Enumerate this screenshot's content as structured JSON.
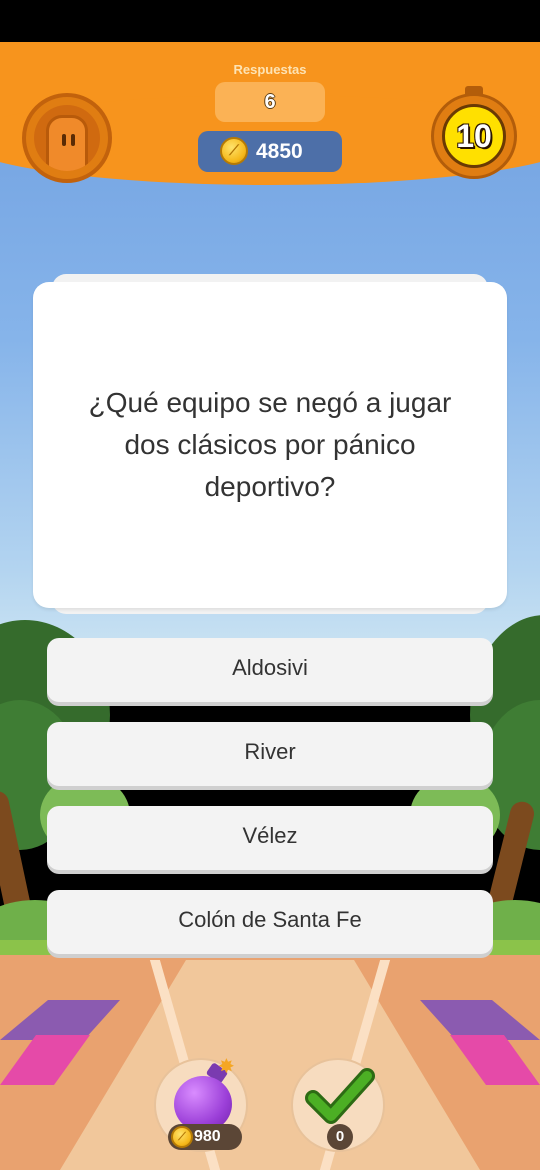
{
  "header": {
    "answers_label": "Respuestas",
    "answers_count": "6",
    "coins": "4850",
    "timer": "10"
  },
  "question": {
    "text": "¿Qué equipo se negó a jugar dos clásicos por pánico deportivo?"
  },
  "options": [
    {
      "label": "Aldosivi"
    },
    {
      "label": "River"
    },
    {
      "label": "Vélez"
    },
    {
      "label": "Colón de Santa Fe"
    }
  ],
  "powerups": {
    "bomb": {
      "icon": "bomb-icon",
      "price": "980"
    },
    "correct": {
      "icon": "checkmark-icon",
      "count": "0"
    }
  },
  "colors": {
    "header_orange": "#f7941d",
    "coin_gold": "#f5b81a",
    "timer_yellow": "#ffe000",
    "bomb_purple": "#9b3fd8",
    "check_green": "#4caf24"
  }
}
